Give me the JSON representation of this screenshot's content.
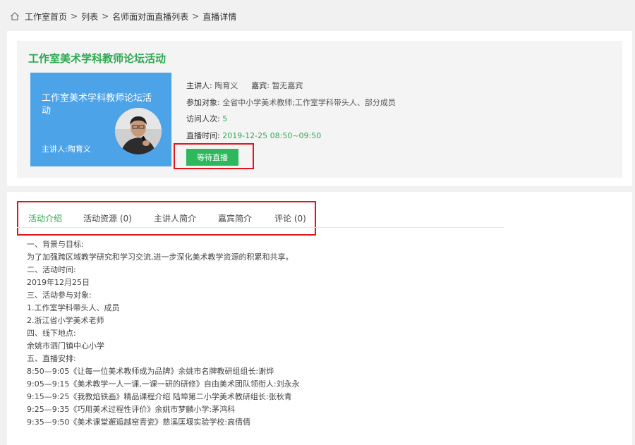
{
  "breadcrumb": {
    "items": [
      "工作室首页",
      "列表",
      "名师面对面直播列表",
      "直播详情"
    ],
    "separator": ">"
  },
  "activity": {
    "title": "工作室美术学科教师论坛活动",
    "cover": {
      "title": "工作室美术学科教师论坛活动",
      "speaker": "主讲人:陶育义"
    },
    "host_label": "主讲人:",
    "host": "陶育义",
    "guest_label": "嘉宾:",
    "guest": "暂无嘉宾",
    "audience_label": "参加对象:",
    "audience": "全省中小学美术教师;工作室学科带头人、部分成员",
    "visits_label": "访问人次:",
    "visits": "5",
    "time_label": "直播时间:",
    "time": "2019-12-25 08:50~09:50",
    "status_button": "等待直播"
  },
  "tabs": [
    {
      "label": "活动介绍"
    },
    {
      "label": "活动资源 (0)"
    },
    {
      "label": "主讲人简介"
    },
    {
      "label": "嘉宾简介"
    },
    {
      "label": "评论 (0)"
    }
  ],
  "content": {
    "lines": [
      "一、背景与目标:",
      "为了加强跨区域教学研究和学习交流,进一步深化美术教学资源的积累和共享。",
      "二、活动时间:",
      "2019年12月25日",
      "三、活动参与对象:",
      "1.工作室学科带头人、成员",
      "2.浙江省小学美术老师",
      "四、线下地点:",
      "余姚市泗门镇中心小学",
      "五、直播安排:",
      "8:50—9:05《让每一位美术教师成为品牌》余姚市名牌教研组组长:谢烨",
      "9:05—9:15《美术教学一人一课,一课一研的研修》自由美术团队领衔人:刘永永",
      "9:15—9:25《我教焰铁画》精品课程介绍 陆埠第二小学美术教研组长:张秋青",
      "9:25—9:35《巧用美术过程性评价》余姚市梦麟小学:茅鸿科",
      "9:35—9:50《美术课堂邂逅越窑青瓷》慈溪匡堰实验学校:高倩倩"
    ]
  },
  "colors": {
    "accent": "#2ea851",
    "button": "#2eb85c",
    "highlight": "#e0161c",
    "cover_bg": "#4da3e8"
  }
}
